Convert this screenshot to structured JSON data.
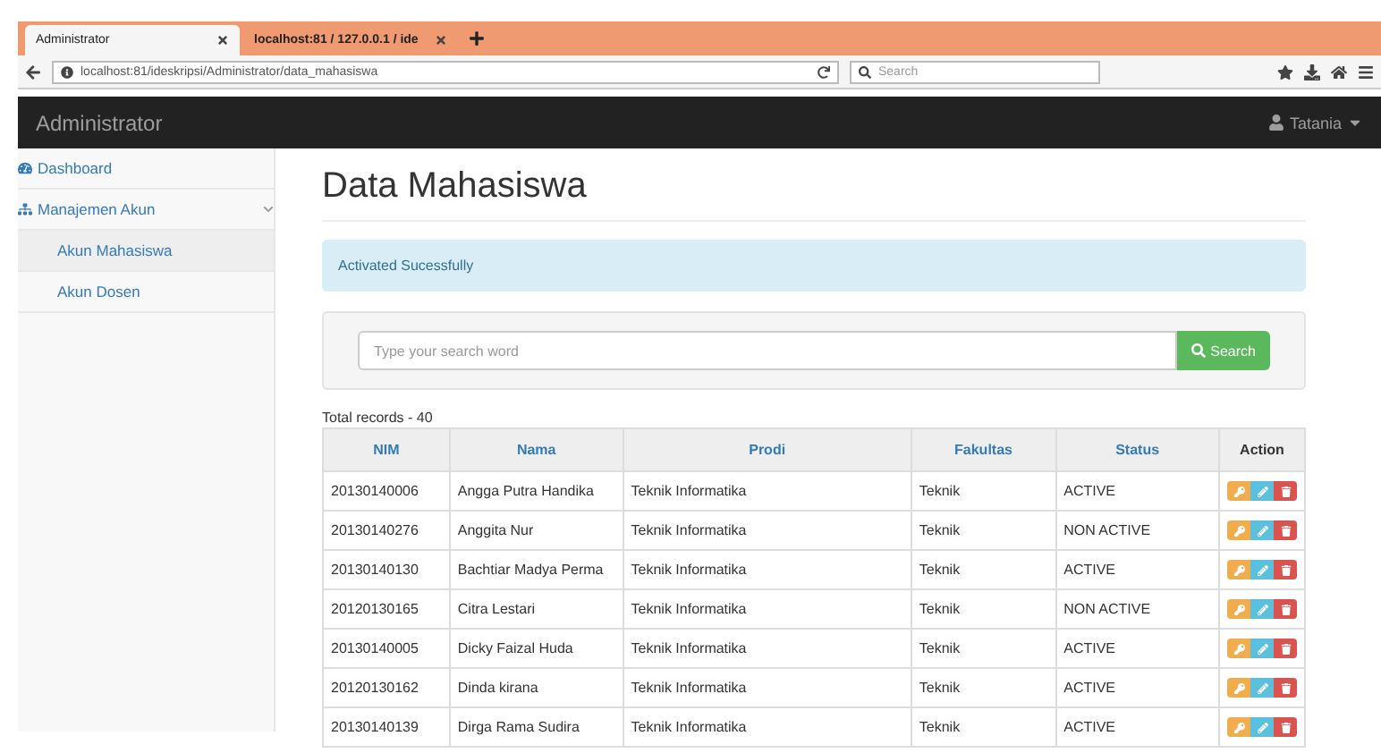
{
  "browser": {
    "tabs": [
      {
        "title": "Administrator",
        "selected": true
      },
      {
        "title": "localhost:81 / 127.0.0.1 / ide",
        "selected": false
      }
    ],
    "url": "localhost:81/ideskripsi/Administrator/data_mahasiswa",
    "search_placeholder": "Search"
  },
  "navbar": {
    "brand": "Administrator",
    "user": "Tatania"
  },
  "sidebar": {
    "items": [
      {
        "label": "Dashboard"
      },
      {
        "label": "Manajemen Akun",
        "expanded": true,
        "children": [
          {
            "label": "Akun Mahasiswa",
            "selected": true
          },
          {
            "label": "Akun Dosen",
            "selected": false
          }
        ]
      }
    ]
  },
  "page": {
    "title": "Data Mahasiswa",
    "alert": "Activated Sucessfully",
    "search": {
      "placeholder": "Type your search word",
      "button": "Search"
    },
    "total": "Total records - 40"
  },
  "table": {
    "columns": [
      {
        "label": "NIM",
        "sortable": true
      },
      {
        "label": "Nama",
        "sortable": true
      },
      {
        "label": "Prodi",
        "sortable": true
      },
      {
        "label": "Fakultas",
        "sortable": true
      },
      {
        "label": "Status",
        "sortable": true
      },
      {
        "label": "Action",
        "sortable": false
      }
    ],
    "rows": [
      [
        "20130140006",
        "Angga Putra Handika",
        "Teknik Informatika",
        "Teknik",
        "ACTIVE"
      ],
      [
        "20130140276",
        "Anggita Nur",
        "Teknik Informatika",
        "Teknik",
        "NON ACTIVE"
      ],
      [
        "20130140130",
        "Bachtiar Madya Perma",
        "Teknik Informatika",
        "Teknik",
        "ACTIVE"
      ],
      [
        "20120130165",
        "Citra Lestari",
        "Teknik Informatika",
        "Teknik",
        "NON ACTIVE"
      ],
      [
        "20130140005",
        "Dicky Faizal Huda",
        "Teknik Informatika",
        "Teknik",
        "ACTIVE"
      ],
      [
        "20120130162",
        "Dinda kirana",
        "Teknik Informatika",
        "Teknik",
        "ACTIVE"
      ],
      [
        "20130140139",
        "Dirga Rama Sudira",
        "Teknik Informatika",
        "Teknik",
        "ACTIVE"
      ]
    ]
  }
}
